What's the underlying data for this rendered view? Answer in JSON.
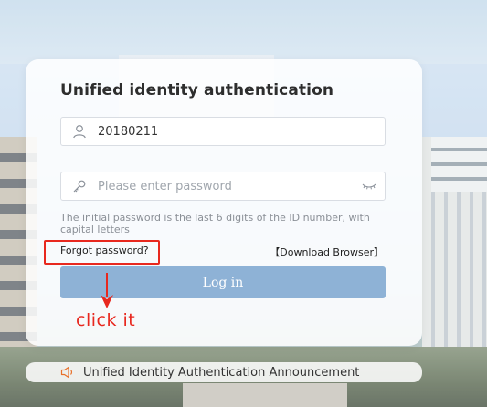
{
  "login": {
    "title": "Unified identity authentication",
    "username_value": "20180211",
    "password_placeholder": "Please enter password",
    "hint": "The initial password is the last 6 digits of the ID number, with capital letters",
    "forgot_password": "Forgot password?",
    "download_browser": "【Download Browser】",
    "login_button": "Log in"
  },
  "annotation": {
    "label": "click it",
    "color": "#e8281e"
  },
  "announcement": {
    "text": "Unified Identity Authentication Announcement"
  },
  "colors": {
    "button": "#8eb2d6",
    "announcement_icon": "#e8702a"
  },
  "icons": {
    "username": "user-icon",
    "password": "key-icon",
    "show_password": "eye-closed-icon",
    "announcement": "speaker-icon"
  }
}
